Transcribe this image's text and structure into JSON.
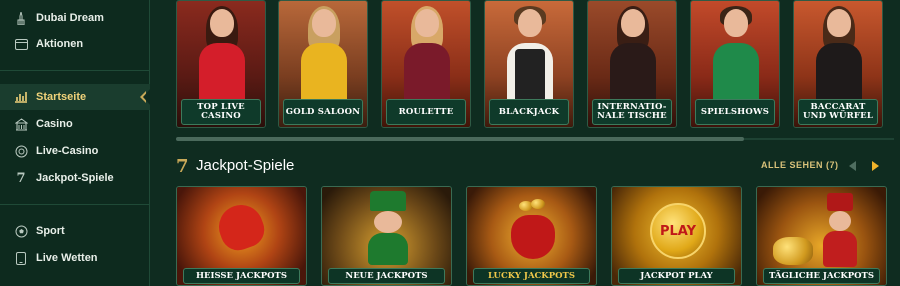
{
  "sidebar": {
    "items": [
      {
        "label": "Dubai Dream",
        "icon": "tower-icon"
      },
      {
        "label": "Aktionen",
        "icon": "card-icon"
      },
      {
        "label": "Startseite",
        "icon": "chart-icon",
        "active": true
      },
      {
        "label": "Casino",
        "icon": "building-icon"
      },
      {
        "label": "Live-Casino",
        "icon": "chip-icon"
      },
      {
        "label": "Jackpot-Spiele",
        "icon": "seven-icon"
      },
      {
        "label": "Sport",
        "icon": "ball-icon"
      },
      {
        "label": "Live Wetten",
        "icon": "phone-icon"
      }
    ]
  },
  "categories": [
    {
      "label": "TOP LIVE CASINO"
    },
    {
      "label": "GOLD SALOON"
    },
    {
      "label": "ROULETTE"
    },
    {
      "label": "BLACKJACK"
    },
    {
      "label": "INTERNATIO-NALE TISCHE"
    },
    {
      "label": "SPIELSHOWS"
    },
    {
      "label": "BACCARAT UND WÜRFEL"
    }
  ],
  "jackpot": {
    "title_icon": "7",
    "title": "Jackpot-Spiele",
    "see_all": "ALLE SEHEN (7)",
    "tiles": [
      {
        "label": "HEISSE JACKPOTS"
      },
      {
        "label": "NEUE JACKPOTS"
      },
      {
        "label": "LUCKY JACKPOTS"
      },
      {
        "label": "JACKPOT PLAY",
        "badge": "PLAY"
      },
      {
        "label": "TÄGLICHE JACKPOTS"
      }
    ]
  },
  "colors": {
    "background": "#0e2a1f",
    "accent_gold": "#c9a959",
    "arrow_active": "#f0b32a"
  }
}
